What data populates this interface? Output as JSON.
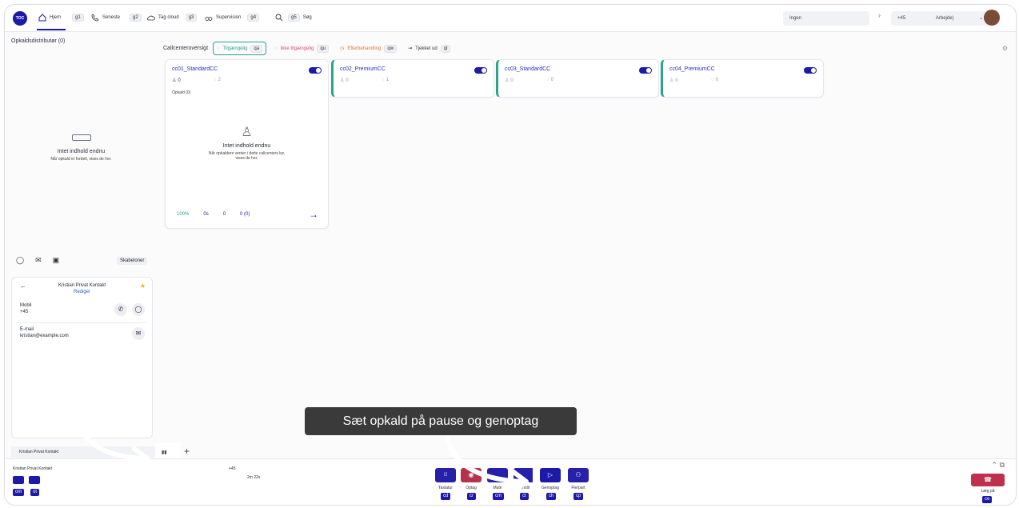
{
  "topbar": {
    "logo": "TOC",
    "nav": [
      {
        "label": "Hjem",
        "key": "g1",
        "icon": "home-icon"
      },
      {
        "label": "Seneste",
        "key": "g2",
        "icon": "phone-icon"
      },
      {
        "label": "Tag cloud",
        "key": "g3",
        "icon": "cloud-icon"
      },
      {
        "label": "Supervision",
        "key": "g4",
        "icon": "binoculars-icon"
      },
      {
        "label": "Søg",
        "key": "g5",
        "icon": "search-icon"
      }
    ],
    "status_select": "Ingen",
    "phone_prefix": "+45",
    "profile": "Arbejde)"
  },
  "left": {
    "title": "Opkaldsdistributør (0)",
    "empty_title": "Intet indhold endnu",
    "empty_desc": "Når opkald er fordelt, vises de her."
  },
  "cc_overview": {
    "label": "Callcenteroversigt",
    "chips": [
      {
        "label": "Tilgængelig",
        "key": "qa",
        "color": "#2aa58a"
      },
      {
        "label": "Ikke tilgængelig",
        "key": "qu",
        "color": "#d4506b"
      },
      {
        "label": "Efterbehandling",
        "key": "qw",
        "color": "#e07a3b"
      },
      {
        "label": "Tjekket ud",
        "key": "ql",
        "color": "#555"
      }
    ]
  },
  "cards": [
    {
      "title": "cc01_StandardCC",
      "agents": "0",
      "queue": "2",
      "calls_label": "Opkald (0)",
      "empty_title": "Intet indhold endnu",
      "empty_desc": "Når opkaldere venter i dette callcenters kø, vises de her.",
      "stats": [
        "100%",
        "0s",
        "0",
        "0 (0)"
      ]
    },
    {
      "title": "cc02_PremiumCC",
      "agents": "0",
      "queue": "1"
    },
    {
      "title": "cc03_StandardCC",
      "agents": "0",
      "queue": "0"
    },
    {
      "title": "cc04_PremiumCC",
      "agents": "0",
      "queue": "0"
    }
  ],
  "contact": {
    "templates": "Skabeloner",
    "name": "Kristian Privat Kontakt",
    "edit": "Rediger",
    "mobile_label": "Mobil",
    "mobile_value": "+45",
    "email_label": "E-mail",
    "email_value": "kristian@example.com"
  },
  "tabs": {
    "active": "Kristian Privat Kontakt"
  },
  "call": {
    "name": "Kristian Privat Kontakt",
    "number": "+45",
    "duration": "2m 22s",
    "left_keys": [
      "om",
      "ot"
    ],
    "controls": [
      {
        "label": "Tastatur",
        "key": "cd"
      },
      {
        "label": "Optag",
        "key": "cr"
      },
      {
        "label": "Mute",
        "key": "cm"
      },
      {
        "label": "Omstil",
        "key": "ct"
      },
      {
        "label": "Genoptag",
        "key": "ch"
      },
      {
        "label": "Flerpart",
        "key": "cp"
      }
    ],
    "hangup_label": "Læg på",
    "hangup_key": "ce"
  },
  "tooltip": "Sæt opkald på pause og genoptag"
}
